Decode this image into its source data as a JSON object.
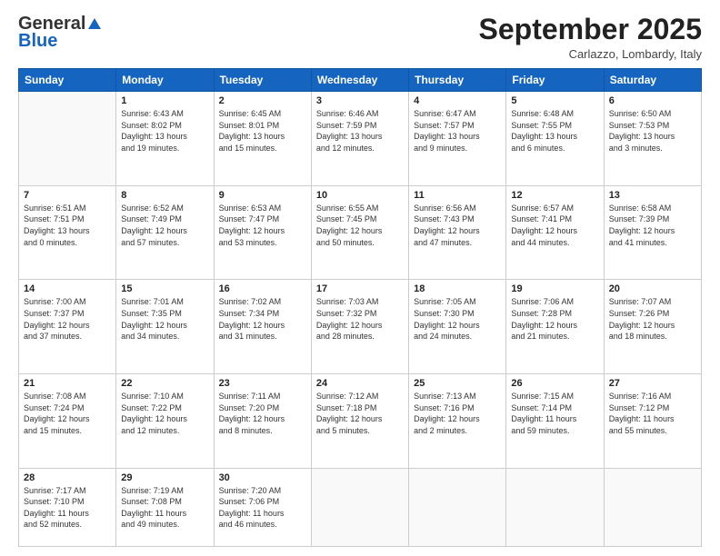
{
  "logo": {
    "general": "General",
    "blue": "Blue"
  },
  "header": {
    "month": "September 2025",
    "location": "Carlazzo, Lombardy, Italy"
  },
  "weekdays": [
    "Sunday",
    "Monday",
    "Tuesday",
    "Wednesday",
    "Thursday",
    "Friday",
    "Saturday"
  ],
  "weeks": [
    [
      {
        "day": "",
        "info": ""
      },
      {
        "day": "1",
        "info": "Sunrise: 6:43 AM\nSunset: 8:02 PM\nDaylight: 13 hours\nand 19 minutes."
      },
      {
        "day": "2",
        "info": "Sunrise: 6:45 AM\nSunset: 8:01 PM\nDaylight: 13 hours\nand 15 minutes."
      },
      {
        "day": "3",
        "info": "Sunrise: 6:46 AM\nSunset: 7:59 PM\nDaylight: 13 hours\nand 12 minutes."
      },
      {
        "day": "4",
        "info": "Sunrise: 6:47 AM\nSunset: 7:57 PM\nDaylight: 13 hours\nand 9 minutes."
      },
      {
        "day": "5",
        "info": "Sunrise: 6:48 AM\nSunset: 7:55 PM\nDaylight: 13 hours\nand 6 minutes."
      },
      {
        "day": "6",
        "info": "Sunrise: 6:50 AM\nSunset: 7:53 PM\nDaylight: 13 hours\nand 3 minutes."
      }
    ],
    [
      {
        "day": "7",
        "info": "Sunrise: 6:51 AM\nSunset: 7:51 PM\nDaylight: 13 hours\nand 0 minutes."
      },
      {
        "day": "8",
        "info": "Sunrise: 6:52 AM\nSunset: 7:49 PM\nDaylight: 12 hours\nand 57 minutes."
      },
      {
        "day": "9",
        "info": "Sunrise: 6:53 AM\nSunset: 7:47 PM\nDaylight: 12 hours\nand 53 minutes."
      },
      {
        "day": "10",
        "info": "Sunrise: 6:55 AM\nSunset: 7:45 PM\nDaylight: 12 hours\nand 50 minutes."
      },
      {
        "day": "11",
        "info": "Sunrise: 6:56 AM\nSunset: 7:43 PM\nDaylight: 12 hours\nand 47 minutes."
      },
      {
        "day": "12",
        "info": "Sunrise: 6:57 AM\nSunset: 7:41 PM\nDaylight: 12 hours\nand 44 minutes."
      },
      {
        "day": "13",
        "info": "Sunrise: 6:58 AM\nSunset: 7:39 PM\nDaylight: 12 hours\nand 41 minutes."
      }
    ],
    [
      {
        "day": "14",
        "info": "Sunrise: 7:00 AM\nSunset: 7:37 PM\nDaylight: 12 hours\nand 37 minutes."
      },
      {
        "day": "15",
        "info": "Sunrise: 7:01 AM\nSunset: 7:35 PM\nDaylight: 12 hours\nand 34 minutes."
      },
      {
        "day": "16",
        "info": "Sunrise: 7:02 AM\nSunset: 7:34 PM\nDaylight: 12 hours\nand 31 minutes."
      },
      {
        "day": "17",
        "info": "Sunrise: 7:03 AM\nSunset: 7:32 PM\nDaylight: 12 hours\nand 28 minutes."
      },
      {
        "day": "18",
        "info": "Sunrise: 7:05 AM\nSunset: 7:30 PM\nDaylight: 12 hours\nand 24 minutes."
      },
      {
        "day": "19",
        "info": "Sunrise: 7:06 AM\nSunset: 7:28 PM\nDaylight: 12 hours\nand 21 minutes."
      },
      {
        "day": "20",
        "info": "Sunrise: 7:07 AM\nSunset: 7:26 PM\nDaylight: 12 hours\nand 18 minutes."
      }
    ],
    [
      {
        "day": "21",
        "info": "Sunrise: 7:08 AM\nSunset: 7:24 PM\nDaylight: 12 hours\nand 15 minutes."
      },
      {
        "day": "22",
        "info": "Sunrise: 7:10 AM\nSunset: 7:22 PM\nDaylight: 12 hours\nand 12 minutes."
      },
      {
        "day": "23",
        "info": "Sunrise: 7:11 AM\nSunset: 7:20 PM\nDaylight: 12 hours\nand 8 minutes."
      },
      {
        "day": "24",
        "info": "Sunrise: 7:12 AM\nSunset: 7:18 PM\nDaylight: 12 hours\nand 5 minutes."
      },
      {
        "day": "25",
        "info": "Sunrise: 7:13 AM\nSunset: 7:16 PM\nDaylight: 12 hours\nand 2 minutes."
      },
      {
        "day": "26",
        "info": "Sunrise: 7:15 AM\nSunset: 7:14 PM\nDaylight: 11 hours\nand 59 minutes."
      },
      {
        "day": "27",
        "info": "Sunrise: 7:16 AM\nSunset: 7:12 PM\nDaylight: 11 hours\nand 55 minutes."
      }
    ],
    [
      {
        "day": "28",
        "info": "Sunrise: 7:17 AM\nSunset: 7:10 PM\nDaylight: 11 hours\nand 52 minutes."
      },
      {
        "day": "29",
        "info": "Sunrise: 7:19 AM\nSunset: 7:08 PM\nDaylight: 11 hours\nand 49 minutes."
      },
      {
        "day": "30",
        "info": "Sunrise: 7:20 AM\nSunset: 7:06 PM\nDaylight: 11 hours\nand 46 minutes."
      },
      {
        "day": "",
        "info": ""
      },
      {
        "day": "",
        "info": ""
      },
      {
        "day": "",
        "info": ""
      },
      {
        "day": "",
        "info": ""
      }
    ]
  ]
}
